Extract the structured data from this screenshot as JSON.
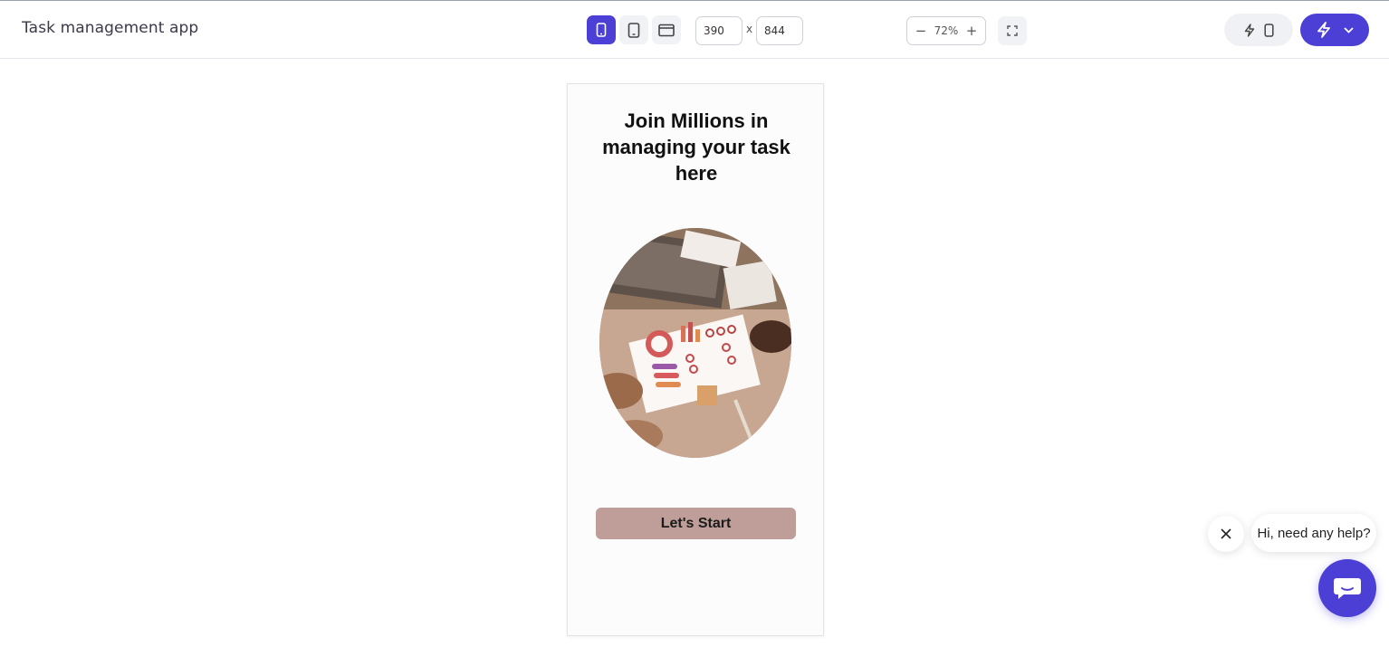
{
  "header": {
    "app_title": "Task management app",
    "device_buttons": [
      {
        "name": "phone",
        "icon": "phone-icon",
        "active": true
      },
      {
        "name": "tablet",
        "icon": "tablet-icon",
        "active": false
      },
      {
        "name": "desktop",
        "icon": "browser-window-icon",
        "active": false
      }
    ],
    "width_value": "390",
    "separator": "x",
    "height_value": "844",
    "zoom": {
      "minus": "−",
      "value": "72%",
      "plus": "+"
    },
    "accent_color": "#4b3fd6"
  },
  "phone": {
    "heading": "Join Millions in managing your task here",
    "hero_image_icon": "photo-team-dashboard-meeting",
    "cta_label": "Let's Start",
    "cta_color": "#bf9d99"
  },
  "chat": {
    "bubble_text": "Hi, need any help?",
    "close_icon": "close-icon",
    "launcher_icon": "chat-icon"
  }
}
